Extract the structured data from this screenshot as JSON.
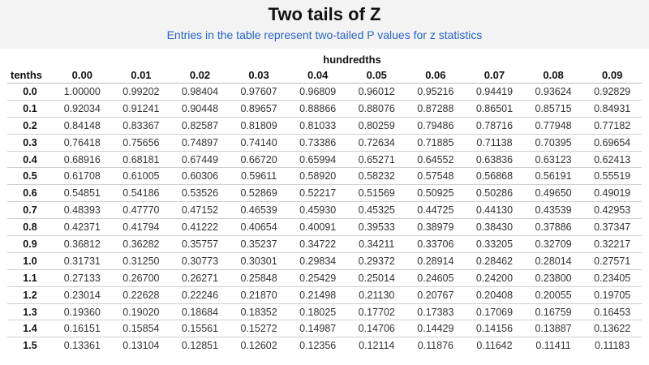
{
  "title": "Two tails of Z",
  "subtitle": "Entries in the table represent two-tailed P values for z statistics",
  "group_header": "hundredths",
  "row_header_label": "tenths",
  "columns": [
    "0.00",
    "0.01",
    "0.02",
    "0.03",
    "0.04",
    "0.05",
    "0.06",
    "0.07",
    "0.08",
    "0.09"
  ],
  "rows": [
    {
      "z": "0.0",
      "values": [
        "1.00000",
        "0.99202",
        "0.98404",
        "0.97607",
        "0.96809",
        "0.96012",
        "0.95216",
        "0.94419",
        "0.93624",
        "0.92829"
      ]
    },
    {
      "z": "0.1",
      "values": [
        "0.92034",
        "0.91241",
        "0.90448",
        "0.89657",
        "0.88866",
        "0.88076",
        "0.87288",
        "0.86501",
        "0.85715",
        "0.84931"
      ]
    },
    {
      "z": "0.2",
      "values": [
        "0.84148",
        "0.83367",
        "0.82587",
        "0.81809",
        "0.81033",
        "0.80259",
        "0.79486",
        "0.78716",
        "0.77948",
        "0.77182"
      ]
    },
    {
      "z": "0.3",
      "values": [
        "0.76418",
        "0.75656",
        "0.74897",
        "0.74140",
        "0.73386",
        "0.72634",
        "0.71885",
        "0.71138",
        "0.70395",
        "0.69654"
      ]
    },
    {
      "z": "0.4",
      "values": [
        "0.68916",
        "0.68181",
        "0.67449",
        "0.66720",
        "0.65994",
        "0.65271",
        "0.64552",
        "0.63836",
        "0.63123",
        "0.62413"
      ]
    },
    {
      "z": "0.5",
      "values": [
        "0.61708",
        "0.61005",
        "0.60306",
        "0.59611",
        "0.58920",
        "0.58232",
        "0.57548",
        "0.56868",
        "0.56191",
        "0.55519"
      ]
    },
    {
      "z": "0.6",
      "values": [
        "0.54851",
        "0.54186",
        "0.53526",
        "0.52869",
        "0.52217",
        "0.51569",
        "0.50925",
        "0.50286",
        "0.49650",
        "0.49019"
      ]
    },
    {
      "z": "0.7",
      "values": [
        "0.48393",
        "0.47770",
        "0.47152",
        "0.46539",
        "0.45930",
        "0.45325",
        "0.44725",
        "0.44130",
        "0.43539",
        "0.42953"
      ]
    },
    {
      "z": "0.8",
      "values": [
        "0.42371",
        "0.41794",
        "0.41222",
        "0.40654",
        "0.40091",
        "0.39533",
        "0.38979",
        "0.38430",
        "0.37886",
        "0.37347"
      ]
    },
    {
      "z": "0.9",
      "values": [
        "0.36812",
        "0.36282",
        "0.35757",
        "0.35237",
        "0.34722",
        "0.34211",
        "0.33706",
        "0.33205",
        "0.32709",
        "0.32217"
      ]
    },
    {
      "z": "1.0",
      "values": [
        "0.31731",
        "0.31250",
        "0.30773",
        "0.30301",
        "0.29834",
        "0.29372",
        "0.28914",
        "0.28462",
        "0.28014",
        "0.27571"
      ]
    },
    {
      "z": "1.1",
      "values": [
        "0.27133",
        "0.26700",
        "0.26271",
        "0.25848",
        "0.25429",
        "0.25014",
        "0.24605",
        "0.24200",
        "0.23800",
        "0.23405"
      ]
    },
    {
      "z": "1.2",
      "values": [
        "0.23014",
        "0.22628",
        "0.22246",
        "0.21870",
        "0.21498",
        "0.21130",
        "0.20767",
        "0.20408",
        "0.20055",
        "0.19705"
      ]
    },
    {
      "z": "1.3",
      "values": [
        "0.19360",
        "0.19020",
        "0.18684",
        "0.18352",
        "0.18025",
        "0.17702",
        "0.17383",
        "0.17069",
        "0.16759",
        "0.16453"
      ]
    },
    {
      "z": "1.4",
      "values": [
        "0.16151",
        "0.15854",
        "0.15561",
        "0.15272",
        "0.14987",
        "0.14706",
        "0.14429",
        "0.14156",
        "0.13887",
        "0.13622"
      ]
    },
    {
      "z": "1.5",
      "values": [
        "0.13361",
        "0.13104",
        "0.12851",
        "0.12602",
        "0.12356",
        "0.12114",
        "0.11876",
        "0.11642",
        "0.11411",
        "0.11183"
      ]
    }
  ],
  "colors": {
    "subtitle": "#2a64c8",
    "header_bg": "#f3f3f3"
  }
}
